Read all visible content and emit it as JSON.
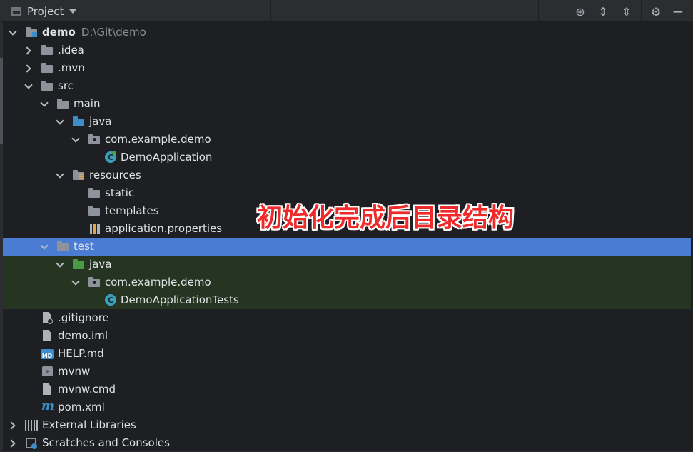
{
  "header": {
    "title": "Project",
    "icons": [
      "locate-icon",
      "expand-all-icon",
      "collapse-all-icon",
      "gear-icon",
      "hide-icon"
    ]
  },
  "tree": [
    {
      "label": "demo",
      "path": "D:\\Git\\demo",
      "bold": true,
      "depth": 0,
      "expanded": true,
      "icon": "module-folder"
    },
    {
      "label": ".idea",
      "depth": 1,
      "expanded": false,
      "icon": "folder"
    },
    {
      "label": ".mvn",
      "depth": 1,
      "expanded": false,
      "icon": "folder"
    },
    {
      "label": "src",
      "depth": 1,
      "expanded": true,
      "icon": "folder"
    },
    {
      "label": "main",
      "depth": 2,
      "expanded": true,
      "icon": "folder"
    },
    {
      "label": "java",
      "depth": 3,
      "expanded": true,
      "icon": "source-folder"
    },
    {
      "label": "com.example.demo",
      "depth": 4,
      "expanded": true,
      "icon": "package"
    },
    {
      "label": "DemoApplication",
      "depth": 5,
      "icon": "spring-class"
    },
    {
      "label": "resources",
      "depth": 3,
      "expanded": true,
      "icon": "resources-folder"
    },
    {
      "label": "static",
      "depth": 4,
      "icon": "folder"
    },
    {
      "label": "templates",
      "depth": 4,
      "icon": "folder"
    },
    {
      "label": "application.properties",
      "depth": 4,
      "icon": "properties-file"
    },
    {
      "label": "test",
      "depth": 2,
      "expanded": true,
      "icon": "folder",
      "selected": true
    },
    {
      "label": "java",
      "depth": 3,
      "expanded": true,
      "icon": "test-folder",
      "test": true
    },
    {
      "label": "com.example.demo",
      "depth": 4,
      "expanded": true,
      "icon": "package",
      "test": true
    },
    {
      "label": "DemoApplicationTests",
      "depth": 5,
      "icon": "class",
      "test": true
    },
    {
      "label": ".gitignore",
      "depth": 1,
      "icon": "ignore-file"
    },
    {
      "label": "demo.iml",
      "depth": 1,
      "icon": "iml-file"
    },
    {
      "label": "HELP.md",
      "depth": 1,
      "icon": "markdown-file"
    },
    {
      "label": "mvnw",
      "depth": 1,
      "icon": "shell-file"
    },
    {
      "label": "mvnw.cmd",
      "depth": 1,
      "icon": "cmd-file"
    },
    {
      "label": "pom.xml",
      "depth": 1,
      "icon": "maven-file"
    },
    {
      "label": "External Libraries",
      "depth": 0,
      "expanded": false,
      "icon": "libraries"
    },
    {
      "label": "Scratches and Consoles",
      "depth": 0,
      "expanded": false,
      "icon": "scratches"
    }
  ],
  "annotation": "初始化完成后目录结构",
  "colors": {
    "selection": "#4a7cd3",
    "test_bg": "#263522",
    "annotation": "#ef2a2a"
  }
}
